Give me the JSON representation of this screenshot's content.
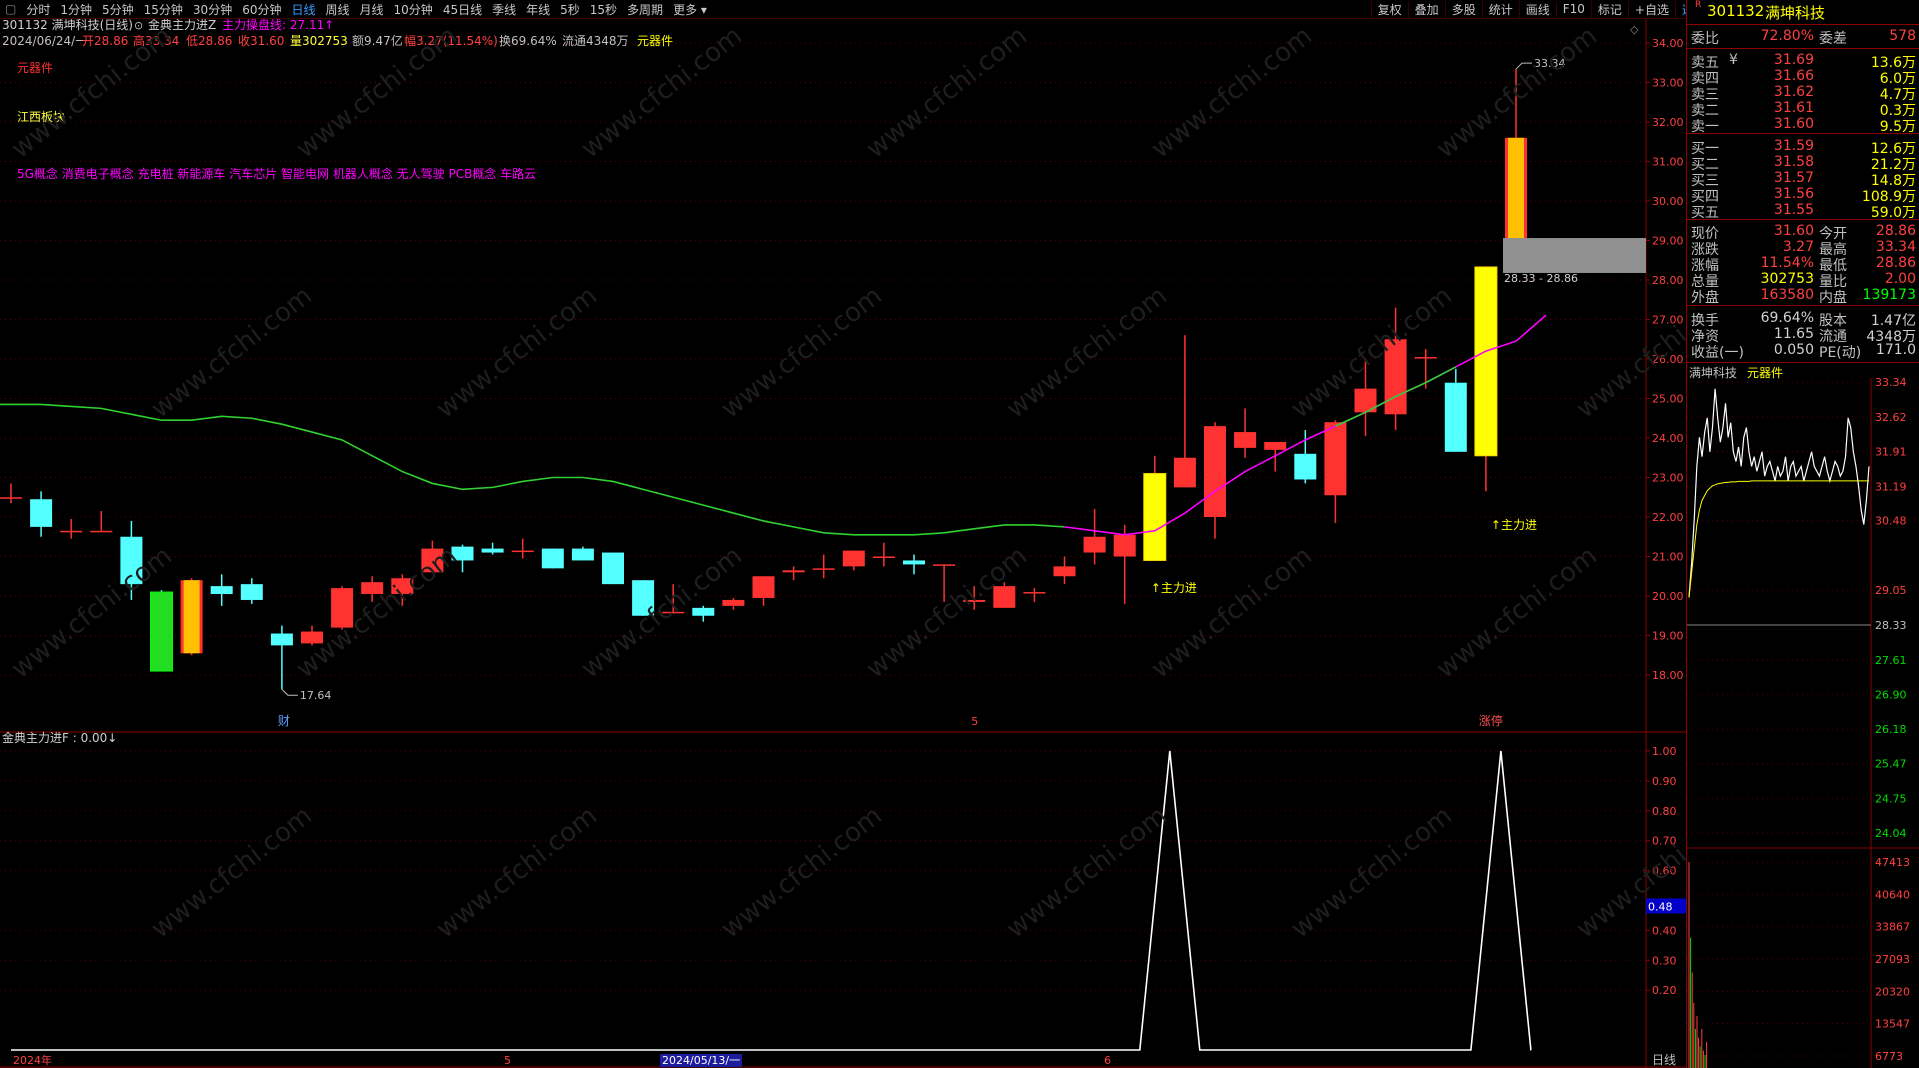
{
  "toolbar": {
    "periods": [
      "分时",
      "1分钟",
      "5分钟",
      "15分钟",
      "30分钟",
      "60分钟",
      "日线",
      "周线",
      "月线",
      "10分钟",
      "45日线",
      "季线",
      "年线",
      "5秒",
      "15秒",
      "多周期",
      "更多"
    ],
    "active_period": "日线",
    "tools": [
      "复权",
      "叠加",
      "多股",
      "统计",
      "画线",
      "F10",
      "标记",
      "+自选",
      "返回"
    ]
  },
  "header": {
    "stock": "301132 满坤科技(日线)",
    "indicator_title": "金典主力进Z",
    "indicator_value": "主力操盘线: 27.11↑",
    "info": {
      "date": "2024/06/24/一",
      "open": "开28.86",
      "high": "高33.34",
      "low": "低28.86",
      "close": "收31.60",
      "volume": "量302753",
      "amount": "额9.47亿",
      "change": "幅3.27(11.54%)",
      "turnover": "换69.64%",
      "float": "流通4348万",
      "sector": "元器件"
    }
  },
  "annotations": {
    "industry": "元器件",
    "region": "江西板块",
    "concepts": "5G概念 消费电子概念 充电桩 新能源车 汽车芯片 智能电网 机器人概念 无人驾驶 PCB概念 车路云",
    "high_label": "33.34",
    "low_label": "17.64",
    "range_label": "28.33 - 28.86",
    "signal_1": "↑主力进",
    "signal_2": "↑主力进",
    "marker_cai": "财",
    "marker_5": "5",
    "marker_zhangting": "涨停",
    "bottom_2024": "2024年",
    "bottom_5": "5",
    "bottom_date": "2024/05/13/一",
    "bottom_6": "6",
    "bottom_period": "日线",
    "sub_title": "金典主力进F : 0.00↓",
    "cursor_value": "0.48"
  },
  "colors": {
    "up": "#ff3232",
    "down": "#54ffff",
    "ma_green": "#2fd22f",
    "ma_magenta": "#ff00ff",
    "yellow": "#ffff00",
    "grid": "#8b0000"
  },
  "chart_data": [
    {
      "type": "candlestick",
      "title": "301132 满坤科技(日线)",
      "ylim": [
        17.5,
        34.3
      ],
      "y_ticks": [
        "34.00",
        "33.00",
        "32.00",
        "31.00",
        "30.00",
        "29.00",
        "28.00",
        "27.00",
        "26.00",
        "25.00",
        "24.00",
        "23.00",
        "22.00",
        "21.00",
        "20.00",
        "19.00",
        "18.00"
      ],
      "candles": [
        {
          "o": 22.5,
          "c": 22.5,
          "h": 22.85,
          "l": 22.35
        },
        {
          "o": 22.45,
          "c": 21.75,
          "h": 22.65,
          "l": 21.5
        },
        {
          "o": 21.65,
          "c": 21.65,
          "h": 21.95,
          "l": 21.45
        },
        {
          "o": 21.65,
          "c": 21.65,
          "h": 22.15,
          "l": 21.65
        },
        {
          "o": 21.5,
          "c": 20.3,
          "h": 21.9,
          "l": 19.9
        },
        {
          "o": 20.1,
          "c": 18.1,
          "h": 20.15,
          "l": 18.1,
          "hl": "green"
        },
        {
          "o": 18.55,
          "c": 20.4,
          "h": 20.45,
          "l": 18.5,
          "hl": "orange"
        },
        {
          "o": 20.25,
          "c": 20.05,
          "h": 20.55,
          "l": 19.75
        },
        {
          "o": 20.3,
          "c": 19.9,
          "h": 20.45,
          "l": 19.8
        },
        {
          "o": 19.05,
          "c": 18.75,
          "h": 19.25,
          "l": 17.64
        },
        {
          "o": 18.8,
          "c": 19.1,
          "h": 19.25,
          "l": 18.75
        },
        {
          "o": 19.2,
          "c": 20.2,
          "h": 20.25,
          "l": 19.15
        },
        {
          "o": 20.05,
          "c": 20.35,
          "h": 20.5,
          "l": 19.85
        },
        {
          "o": 20.05,
          "c": 20.45,
          "h": 20.55,
          "l": 19.75
        },
        {
          "o": 20.6,
          "c": 21.2,
          "h": 21.4,
          "l": 20.6
        },
        {
          "o": 21.25,
          "c": 20.9,
          "h": 21.3,
          "l": 20.6
        },
        {
          "o": 21.2,
          "c": 21.1,
          "h": 21.35,
          "l": 21.05
        },
        {
          "o": 21.15,
          "c": 21.15,
          "h": 21.45,
          "l": 20.95
        },
        {
          "o": 21.2,
          "c": 20.7,
          "h": 21.2,
          "l": 20.7
        },
        {
          "o": 21.2,
          "c": 20.9,
          "h": 21.25,
          "l": 20.9
        },
        {
          "o": 21.1,
          "c": 20.3,
          "h": 21.1,
          "l": 20.3
        },
        {
          "o": 20.4,
          "c": 19.5,
          "h": 20.4,
          "l": 19.5
        },
        {
          "o": 19.6,
          "c": 19.6,
          "h": 20.3,
          "l": 19.55
        },
        {
          "o": 19.7,
          "c": 19.5,
          "h": 19.75,
          "l": 19.35
        },
        {
          "o": 19.75,
          "c": 19.9,
          "h": 19.95,
          "l": 19.65
        },
        {
          "o": 19.95,
          "c": 20.5,
          "h": 20.5,
          "l": 19.75
        },
        {
          "o": 20.6,
          "c": 20.65,
          "h": 20.75,
          "l": 20.4
        },
        {
          "o": 20.7,
          "c": 20.7,
          "h": 21.05,
          "l": 20.45
        },
        {
          "o": 20.75,
          "c": 21.15,
          "h": 21.15,
          "l": 20.65
        },
        {
          "o": 21.0,
          "c": 21.0,
          "h": 21.35,
          "l": 20.75
        },
        {
          "o": 20.9,
          "c": 20.8,
          "h": 21.05,
          "l": 20.55
        },
        {
          "o": 20.8,
          "c": 20.8,
          "h": 20.8,
          "l": 19.85
        },
        {
          "o": 19.85,
          "c": 19.9,
          "h": 20.25,
          "l": 19.65
        },
        {
          "o": 19.7,
          "c": 20.25,
          "h": 20.35,
          "l": 19.7
        },
        {
          "o": 20.1,
          "c": 20.1,
          "h": 20.2,
          "l": 19.85
        },
        {
          "o": 20.5,
          "c": 20.75,
          "h": 21.0,
          "l": 20.3
        },
        {
          "o": 21.1,
          "c": 21.5,
          "h": 22.2,
          "l": 20.8
        },
        {
          "o": 21.0,
          "c": 21.55,
          "h": 21.8,
          "l": 19.8
        },
        {
          "o": 20.9,
          "c": 23.1,
          "h": 23.55,
          "l": 20.9,
          "hl": "yellow"
        },
        {
          "o": 22.75,
          "c": 23.5,
          "h": 26.6,
          "l": 22.75
        },
        {
          "o": 22.0,
          "c": 24.3,
          "h": 24.4,
          "l": 21.45
        },
        {
          "o": 23.75,
          "c": 24.15,
          "h": 24.75,
          "l": 23.5
        },
        {
          "o": 23.7,
          "c": 23.9,
          "h": 23.9,
          "l": 23.15
        },
        {
          "o": 23.6,
          "c": 22.95,
          "h": 24.2,
          "l": 22.85
        },
        {
          "o": 22.55,
          "c": 24.4,
          "h": 24.45,
          "l": 21.85
        },
        {
          "o": 24.65,
          "c": 25.25,
          "h": 25.95,
          "l": 24.05
        },
        {
          "o": 24.6,
          "c": 26.5,
          "h": 27.3,
          "l": 24.2
        },
        {
          "o": 26.05,
          "c": 26.05,
          "h": 26.25,
          "l": 25.25
        },
        {
          "o": 25.4,
          "c": 23.65,
          "h": 25.75,
          "l": 23.65
        },
        {
          "o": 23.55,
          "c": 28.33,
          "h": 28.33,
          "l": 22.65,
          "hl": "yellow"
        },
        {
          "o": 28.86,
          "c": 31.6,
          "h": 33.34,
          "l": 28.86,
          "hl": "orange"
        }
      ],
      "ma_line": [
        24.85,
        24.85,
        24.8,
        24.75,
        24.6,
        24.45,
        24.45,
        24.55,
        24.5,
        24.35,
        24.15,
        23.95,
        23.55,
        23.15,
        22.85,
        22.7,
        22.75,
        22.9,
        23.0,
        23.0,
        22.9,
        22.7,
        22.5,
        22.3,
        22.1,
        21.9,
        21.75,
        21.6,
        21.55,
        21.55,
        21.55,
        21.6,
        21.7,
        21.8,
        21.8,
        21.75,
        21.65,
        21.55,
        21.65,
        22.1,
        22.65,
        23.15,
        23.55,
        23.95,
        24.3,
        24.65,
        25.05,
        25.4,
        25.8,
        26.2,
        26.45,
        27.11
      ],
      "ma_magenta_from": 35
    },
    {
      "type": "line",
      "title": "金典主力进F",
      "ylim": [
        0,
        1.0
      ],
      "y_ticks": [
        "1.00",
        "0.90",
        "0.80",
        "0.70",
        "0.60",
        "0.40",
        "0.30",
        "0.20"
      ],
      "values": [
        0,
        0,
        0,
        0,
        0,
        0,
        0,
        0,
        0,
        0,
        0,
        0,
        0,
        0,
        0,
        0,
        0,
        0,
        0,
        0,
        0,
        0,
        0,
        0,
        0,
        0,
        0,
        0,
        0,
        0,
        0,
        0,
        0,
        0,
        0,
        0,
        0,
        0,
        1,
        0,
        0,
        0,
        0,
        0,
        0,
        0,
        0,
        0,
        0,
        1,
        0
      ]
    }
  ],
  "quote": {
    "title_code": "301132",
    "title_name": "满坤科技",
    "r_mark": "R",
    "weibi_label": "委比",
    "weibi": "72.80%",
    "weicha_label": "委差",
    "weicha": "578",
    "sells": [
      {
        "label": "卖五",
        "tag": "¥",
        "price": "31.69",
        "vol": "13.6万"
      },
      {
        "label": "卖四",
        "tag": "",
        "price": "31.66",
        "vol": "6.0万"
      },
      {
        "label": "卖三",
        "tag": "",
        "price": "31.62",
        "vol": "4.7万"
      },
      {
        "label": "卖二",
        "tag": "",
        "price": "31.61",
        "vol": "0.3万"
      },
      {
        "label": "卖一",
        "tag": "",
        "price": "31.60",
        "vol": "9.5万"
      }
    ],
    "buys": [
      {
        "label": "买一",
        "price": "31.59",
        "vol": "12.6万"
      },
      {
        "label": "买二",
        "price": "31.58",
        "vol": "21.2万"
      },
      {
        "label": "买三",
        "price": "31.57",
        "vol": "14.8万"
      },
      {
        "label": "买四",
        "price": "31.56",
        "vol": "108.9万"
      },
      {
        "label": "买五",
        "price": "31.55",
        "vol": "59.0万"
      }
    ],
    "stats": [
      {
        "l1": "现价",
        "v1": "31.60",
        "l2": "今开",
        "v2": "28.86"
      },
      {
        "l1": "涨跌",
        "v1": "3.27",
        "l2": "最高",
        "v2": "33.34"
      },
      {
        "l1": "涨幅",
        "v1": "11.54%",
        "l2": "最低",
        "v2": "28.86"
      },
      {
        "l1": "总量",
        "v1": "302753",
        "l2": "量比",
        "v2": "2.00"
      },
      {
        "l1": "外盘",
        "v1": "163580",
        "l2": "内盘",
        "v2": "139173"
      }
    ],
    "stats2": [
      {
        "l1": "换手",
        "v1": "69.64%",
        "l2": "股本",
        "v2": "1.47亿"
      },
      {
        "l1": "净资",
        "v1": "11.65",
        "l2": "流通",
        "v2": "4348万"
      },
      {
        "l1": "收益(一)",
        "v1": "0.050",
        "l2": "PE(动)",
        "v2": "171.0"
      }
    ],
    "mini_name": "满坤科技",
    "mini_sector": "元器件",
    "mini_price_ticks": [
      "33.34",
      "32.62",
      "31.91",
      "31.19",
      "30.48",
      "29.05",
      "28.33",
      "27.61",
      "26.90",
      "26.18",
      "25.47",
      "24.75",
      "24.04"
    ],
    "mini_vol_ticks": [
      "47413",
      "40640",
      "33867",
      "27093",
      "20320",
      "13547",
      "6773"
    ],
    "intraday": [
      28.9,
      29.6,
      30.5,
      31.6,
      32.2,
      31.8,
      32.3,
      32.6,
      31.9,
      32.4,
      33.2,
      32.6,
      32.1,
      32.4,
      32.9,
      32.2,
      32.5,
      31.9,
      31.7,
      32.0,
      31.6,
      32.2,
      32.4,
      31.9,
      31.6,
      31.8,
      31.5,
      31.7,
      31.9,
      31.4,
      31.6,
      31.7,
      31.5,
      31.3,
      31.6,
      31.4,
      31.5,
      31.8,
      31.3,
      31.6,
      31.7,
      31.4,
      31.5,
      31.6,
      31.3,
      31.5,
      31.7,
      31.9,
      31.6,
      31.5,
      31.4,
      31.6,
      31.8,
      31.5,
      31.3,
      31.5,
      31.7,
      31.6,
      31.4,
      31.5,
      31.8,
      32.6,
      32.4,
      31.9,
      31.6,
      31.2,
      30.7,
      30.4,
      30.9,
      31.6
    ],
    "intraday_avg": [
      28.9,
      29.4,
      29.9,
      30.4,
      30.7,
      30.9,
      31.0,
      31.1,
      31.15,
      31.2,
      31.22,
      31.24,
      31.25,
      31.26,
      31.27,
      31.27,
      31.28,
      31.28,
      31.28,
      31.29,
      31.29,
      31.29,
      31.29,
      31.29,
      31.3,
      31.3,
      31.3,
      31.3,
      31.3,
      31.3,
      31.3,
      31.3,
      31.3,
      31.3,
      31.3,
      31.3,
      31.3,
      31.3,
      31.3,
      31.3,
      31.3,
      31.3,
      31.3,
      31.3,
      31.3,
      31.3,
      31.3,
      31.3,
      31.3,
      31.3,
      31.3,
      31.3,
      31.3,
      31.3,
      31.3,
      31.3,
      31.3,
      31.3,
      31.3,
      31.3,
      31.3,
      31.3,
      31.3,
      31.3,
      31.3,
      31.3,
      31.3,
      31.3,
      31.3,
      31.3
    ],
    "intraday_vol": [
      47413,
      30000,
      22000,
      15000,
      9000,
      12000,
      7000,
      5000,
      9000,
      4000,
      3000,
      6000
    ]
  }
}
